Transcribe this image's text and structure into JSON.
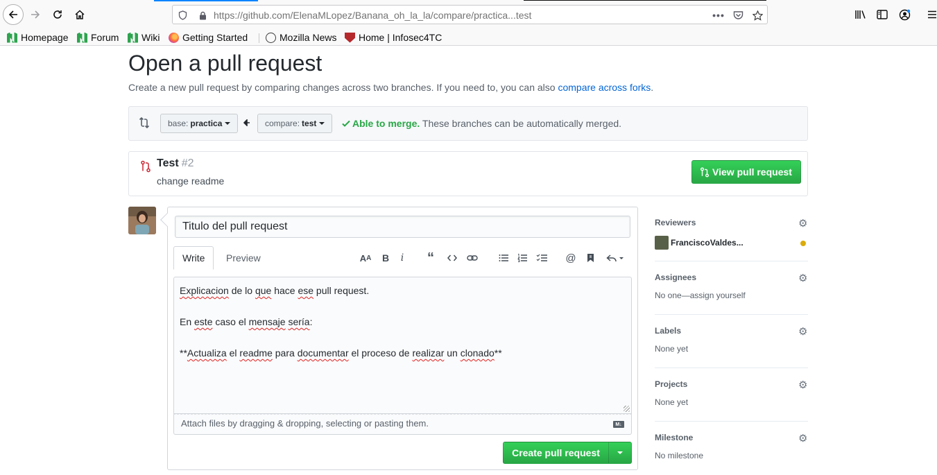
{
  "browser": {
    "url_prefix": "https://github.com",
    "url_path": "/ElenaMLopez/Banana_oh_la_la/compare/practica...test",
    "bookmarks": [
      {
        "label": "Homepage",
        "icon": "moodle-icon"
      },
      {
        "label": "Forum",
        "icon": "moodle-icon"
      },
      {
        "label": "Wiki",
        "icon": "moodle-icon"
      },
      {
        "label": "Getting Started",
        "icon": "firefox-icon"
      },
      {
        "label": "Mozilla News",
        "icon": "globe-icon"
      },
      {
        "label": "Home | Infosec4TC",
        "icon": "shield-icon"
      }
    ]
  },
  "page": {
    "title": "Open a pull request",
    "subtitle": "Create a new pull request by comparing changes across two branches. If you need to, you can also ",
    "subtitle_link": "compare across forks",
    "subtitle_end": "."
  },
  "range": {
    "base_label": "base:",
    "base_value": "practica",
    "compare_label": "compare:",
    "compare_value": "test",
    "merge_ok": "Able to merge.",
    "merge_msg": " These branches can be automatically merged."
  },
  "existing_pr": {
    "title": "Test",
    "number": "#2",
    "description": "change readme",
    "button": "View pull request"
  },
  "composer": {
    "title_value": "Titulo del pull request",
    "tab_write": "Write",
    "tab_preview": "Preview",
    "body_line1_words": [
      "Explicacion",
      " de lo ",
      "que",
      " hace ",
      "ese",
      " pull request."
    ],
    "body_line3_words": [
      "En ",
      "este",
      " caso el ",
      "mensaje",
      " ",
      "sería",
      ":"
    ],
    "body_line5_words": [
      "**",
      "Actualiza",
      " el ",
      "readme",
      " para ",
      "documentar",
      " el proceso de ",
      "realizar",
      " un ",
      "clonado",
      "**"
    ],
    "attach_hint": "Attach files by dragging & dropping, selecting or pasting them.",
    "submit": "Create pull request"
  },
  "sidebar": {
    "reviewers": {
      "heading": "Reviewers",
      "name": "FranciscoValdes..."
    },
    "assignees": {
      "heading": "Assignees",
      "value": "No one—assign yourself"
    },
    "labels": {
      "heading": "Labels",
      "value": "None yet"
    },
    "projects": {
      "heading": "Projects",
      "value": "None yet"
    },
    "milestone": {
      "heading": "Milestone",
      "value": "No milestone"
    }
  },
  "colors": {
    "accent_link": "#0366d6",
    "success_green": "#28a745",
    "pending_dot": "#dbab09",
    "closed_red": "#cb2431"
  }
}
